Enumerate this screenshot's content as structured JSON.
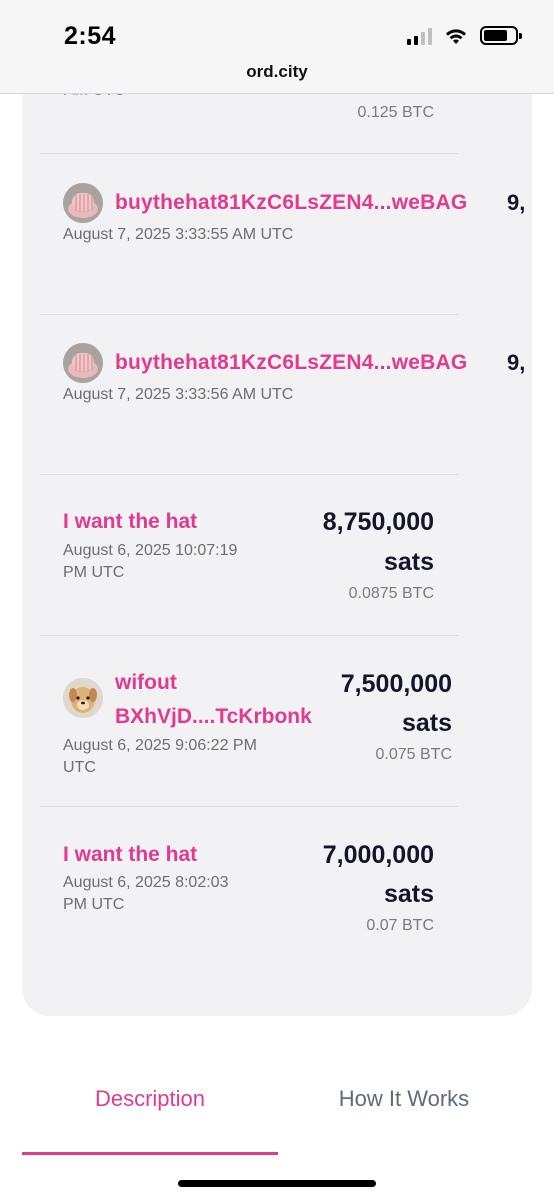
{
  "status": {
    "time": "2:54"
  },
  "browser": {
    "url": "ord.city"
  },
  "bids": [
    {
      "meta": "AM UTC",
      "btc": "0.125 BTC"
    },
    {
      "name": "buythehat81KzC6LsZEN4...weBAG",
      "trail": "9,",
      "meta": "August 7, 2025 3:33:55 AM UTC"
    },
    {
      "name": "buythehat81KzC6LsZEN4...weBAG",
      "trail": "9,",
      "meta": "August 7, 2025 3:33:56 AM UTC"
    },
    {
      "name": "I want the hat",
      "meta_line1": "August 6, 2025 10:07:19",
      "meta_line2": "PM UTC",
      "amount": "8,750,000",
      "unit": "sats",
      "btc": "0.0875 BTC"
    },
    {
      "name_line1": "wifout",
      "name_line2": "BXhVjD....TcKrbonk",
      "meta_line1": "August 6, 2025 9:06:22 PM",
      "meta_line2": "UTC",
      "amount": "7,500,000",
      "unit": "sats",
      "btc": "0.075 BTC"
    },
    {
      "name": "I want the hat",
      "meta_line1": "August 6, 2025 8:02:03",
      "meta_line2": "PM UTC",
      "amount": "7,000,000",
      "unit": "sats",
      "btc": "0.07 BTC"
    }
  ],
  "tabs": {
    "description": "Description",
    "how_it_works": "How It Works"
  },
  "colors": {
    "accent": "#e23b8e",
    "card": "#f2f2f5"
  }
}
